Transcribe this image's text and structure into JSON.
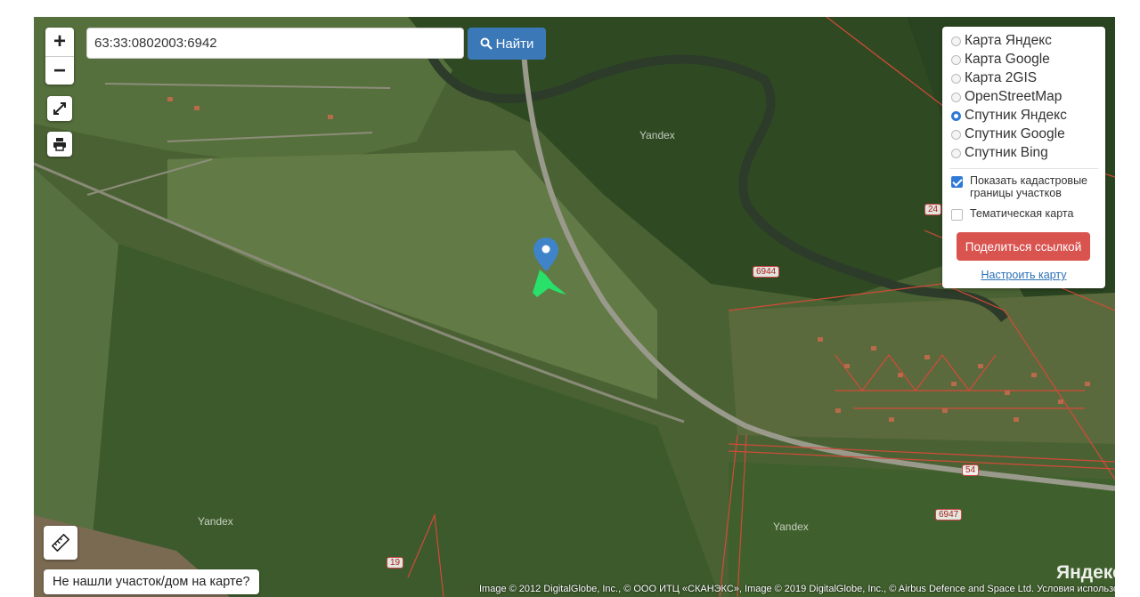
{
  "map": {
    "search": {
      "value": "63:33:0802003:6942"
    },
    "find_label": "Найти",
    "zoom_in": "+",
    "zoom_out": "−",
    "layers": [
      {
        "label": "Карта Яндекс",
        "selected": false
      },
      {
        "label": "Карта Google",
        "selected": false
      },
      {
        "label": "Карта 2GIS",
        "selected": false
      },
      {
        "label": "OpenStreetMap",
        "selected": false
      },
      {
        "label": "Спутник Яндекс",
        "selected": true
      },
      {
        "label": "Спутник Google",
        "selected": false
      },
      {
        "label": "Спутник Bing",
        "selected": false
      }
    ],
    "options": [
      {
        "label": "Показать кадастровые границы участков",
        "checked": true
      },
      {
        "label": "Тематическая карта",
        "checked": false
      }
    ],
    "share_label": "Поделиться ссылкой",
    "setup_label": "Настроить карту",
    "not_found_label": "Не нашли участок/дом на карте?",
    "attribution": "Image © 2012 DigitalGlobe, Inc., © ООО ИТЦ «СКАНЭКС», Image © 2019 DigitalGlobe, Inc., © Airbus Defence and Space Ltd.  Условия использования",
    "yandex_logo": "Яндекс",
    "watermarks": [
      "Yandex",
      "Yandex",
      "Yandex"
    ],
    "parcel_labels": [
      "6944",
      "6947",
      "54",
      "19",
      "24"
    ],
    "accent_color": "#3a78b8",
    "share_color": "#d9534f"
  }
}
